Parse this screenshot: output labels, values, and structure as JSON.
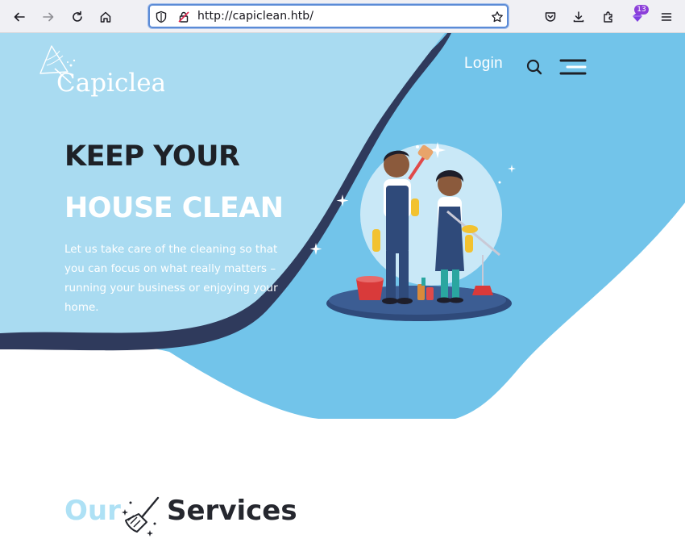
{
  "browser": {
    "url": "http://capiclean.htb/",
    "extension_badge": "13",
    "icons": [
      "back-arrow-icon",
      "forward-arrow-icon",
      "reload-icon",
      "home-icon",
      "shield-icon",
      "lock-insecure-icon",
      "bookmark-star-icon",
      "pocket-icon",
      "downloads-icon",
      "extensions-icon",
      "extension-purple-icon",
      "hamburger-menu-icon"
    ]
  },
  "site": {
    "logo_text": "Capiclean",
    "nav": {
      "login_label": "Login",
      "search_icon": "search-icon",
      "menu_icon": "hamburger-menu-icon"
    },
    "hero": {
      "headline_line1": "KEEP YOUR",
      "headline_line2": "HOUSE CLEAN",
      "description": "Let us take care of the cleaning so that you can focus on what really matters – running your business or enjoying your home."
    },
    "services": {
      "title_prefix": "Our",
      "title_suffix": "Services",
      "icon": "broom-icon"
    }
  },
  "colors": {
    "hero_light_blue": "#a9dbf1",
    "hero_mid_blue": "#72c4ea",
    "hero_dark_edge": "#2f3a5c",
    "headline_dark": "#1e2127",
    "accent_light": "#aee1f5"
  }
}
